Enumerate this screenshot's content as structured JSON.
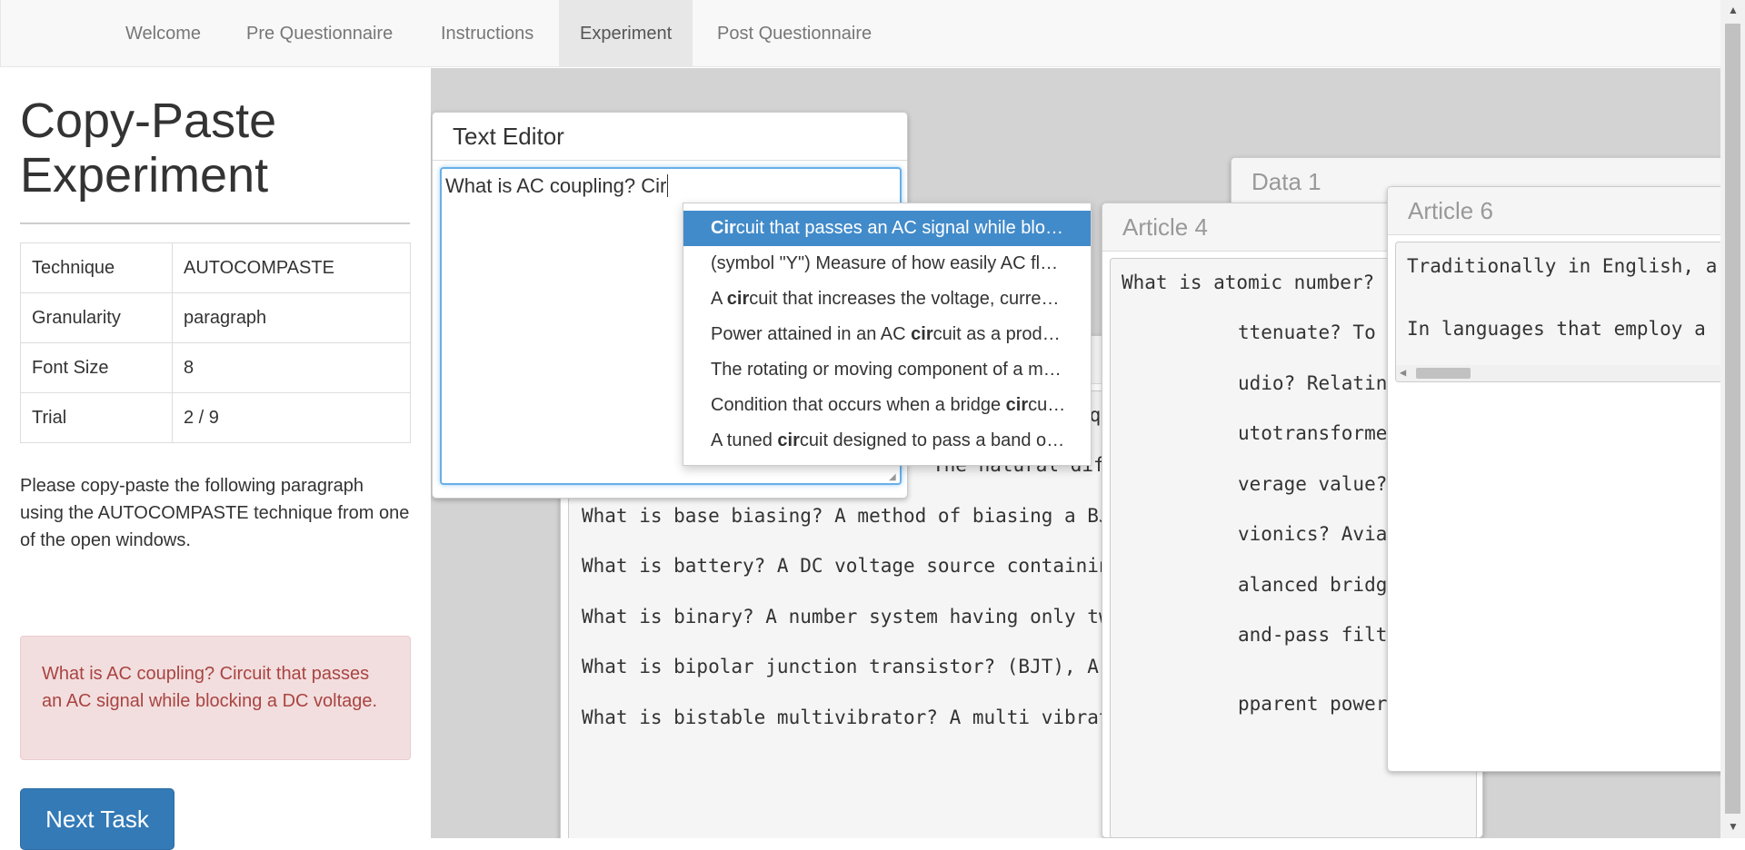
{
  "nav": {
    "tabs": [
      {
        "label": "Welcome"
      },
      {
        "label": "Pre Questionnaire"
      },
      {
        "label": "Instructions"
      },
      {
        "label": "Experiment"
      },
      {
        "label": "Post Questionnaire"
      }
    ],
    "active": "Experiment"
  },
  "sidebar": {
    "title": "Copy-Paste Experiment",
    "rows": [
      {
        "key": "Technique",
        "value": "AUTOCOMPASTE"
      },
      {
        "key": "Granularity",
        "value": "paragraph"
      },
      {
        "key": "Font Size",
        "value": "8"
      },
      {
        "key": "Trial",
        "value": "2 / 9"
      }
    ],
    "instructions": "Please copy-paste the following paragraph using the AUTOCOMPASTE technique from one of the open windows.",
    "target_text": "What is AC coupling? Circuit that passes an AC signal while blocking a DC voltage.",
    "next_label": "Next Task"
  },
  "editor": {
    "title": "Text Editor",
    "value": "What is AC coupling? Cir"
  },
  "dropdown": {
    "items": [
      {
        "pre": "",
        "bold": "Cir",
        "post": "cuit that passes an AC signal while blocking a DC voltage."
      },
      {
        "pre": "(symbol \"Y\") Measure of how easily AC flows through a circuit",
        "bold": "",
        "post": ""
      },
      {
        "pre": "A ",
        "bold": "cir",
        "post": "cuit that increases the voltage, current or power"
      },
      {
        "pre": "Power attained in an AC ",
        "bold": "cir",
        "post": "cuit as a product of voltage"
      },
      {
        "pre": "The rotating or moving component of a motor",
        "bold": "",
        "post": ""
      },
      {
        "pre": "Condition that occurs when a bridge ",
        "bold": "cir",
        "post": "cuit is balanced"
      },
      {
        "pre": "A tuned ",
        "bold": "cir",
        "post": "cuit designed to pass a band of frequencies"
      }
    ]
  },
  "windows": {
    "data1": {
      "title": "Data 1"
    },
    "article4": {
      "title": "Article 4",
      "lines": [
        "What is atomic number?",
        "ttenuate? To",
        "udio? Relatin",
        "utotransforme",
        "verage value?",
        "vionics? Avia",
        "alanced bridg",
        "and-pass filt",
        "pparent power? Power attained in an AC ci"
      ]
    },
    "article6": {
      "title": "Article 6",
      "lines": [
        "Traditionally in English, a",
        "In languages that employ a"
      ]
    },
    "back": {
      "lines": [
        "equencies be",
        "The natural difference of p",
        "What is base biasing? A method of biasing a BJT in whi",
        "What is battery? A DC voltage source containing two or",
        "What is binary? A number system having only two symbol",
        "What is bipolar junction transistor? (BJT), A three te",
        "What is bistable multivibrator? A multi vibrator with"
      ]
    }
  },
  "colors": {
    "primary": "#337ab7",
    "alert_bg": "#f2dede",
    "alert_text": "#a94442",
    "highlight": "#428bca"
  }
}
